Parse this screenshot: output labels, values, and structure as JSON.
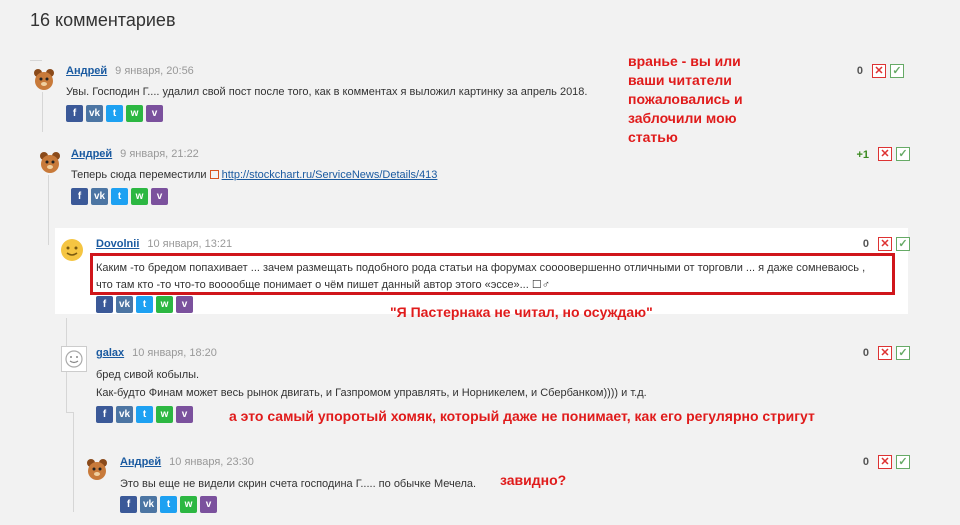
{
  "title": "16 комментариев",
  "comments": [
    {
      "author": "Андрей",
      "date": "9 января, 20:56",
      "text": "Увы. Господин Г.... удалил свой пост после того, как в комментах я выложил картинку за апрель 2018.",
      "score": "0"
    },
    {
      "author": "Андрей",
      "date": "9 января, 21:22",
      "text_prefix": "Теперь сюда переместили",
      "link": "http://stockchart.ru/ServiceNews/Details/413",
      "score": "+1"
    },
    {
      "author": "Dovolnii",
      "date": "10 января, 13:21",
      "line1": "Каким -то бредом попахивает ... зачем размещать подобного рода статьи на форумах соооовершенно отличными от торговли ... я даже сомневаюсь ,",
      "line2": "что там кто -то что-то вооообще понимает о чём пишет данный автор этого «эссе»... ☐♂",
      "score": "0"
    },
    {
      "author": "galax",
      "date": "10 января, 18:20",
      "line1": "бред сивой кобылы.",
      "line2": "Как-будто Финам может весь рынок двигать, и Газпромом управлять, и Норникелем, и Сбербанком)))) и т.д.",
      "score": "0"
    },
    {
      "author": "Андрей",
      "date": "10 января, 23:30",
      "text": "Это вы еще не видели скрин счета господина Г..... по обычке Мечела.",
      "score": "0"
    }
  ],
  "share": {
    "fb": "f",
    "vk": "vk",
    "tw": "t",
    "wa": "w",
    "vb": "v"
  },
  "vote": {
    "minus": "✕",
    "plus": "✓"
  },
  "annotations": {
    "a1_l1": "вранье - вы или",
    "a1_l2": "ваши читатели",
    "a1_l3": "пожаловались и",
    "a1_l4": "заблочили мою",
    "a1_l5": "статью",
    "a2": "\"Я Пастернака не читал, но осуждаю\"",
    "a3": "а это самый упоротый хомяк, который даже не понимает, как его регулярно стригут",
    "a4": "завидно?"
  },
  "colors": {
    "annotation": "#e01b1b",
    "author": "#1a5aa0",
    "positive": "#3a8a20"
  }
}
